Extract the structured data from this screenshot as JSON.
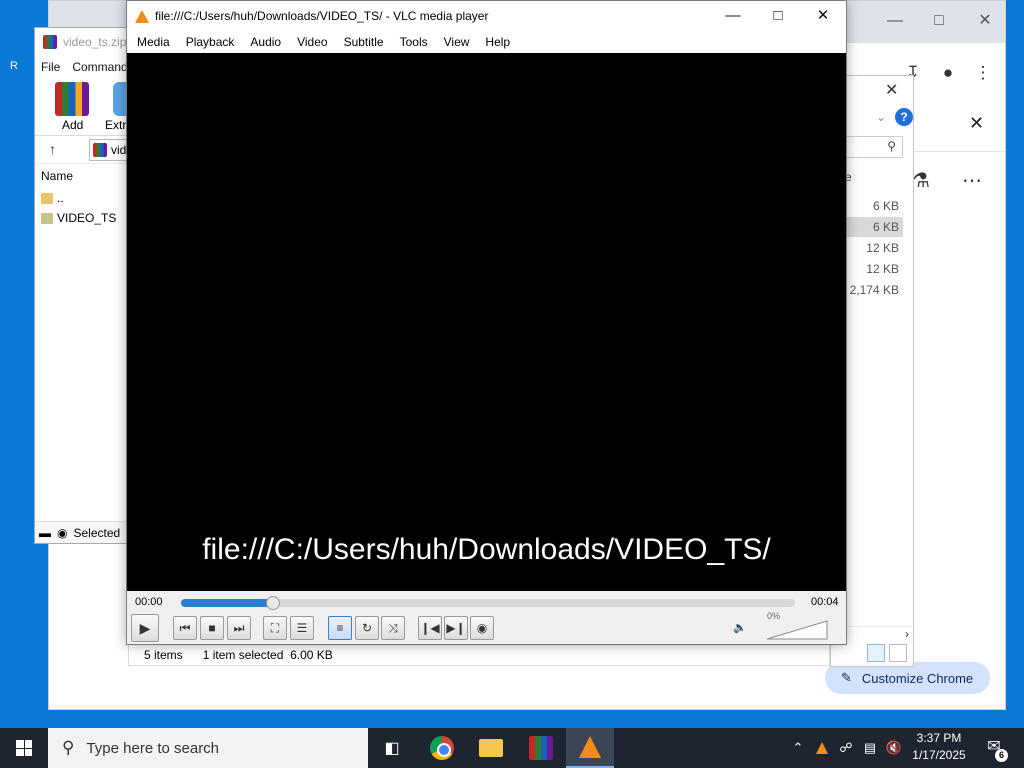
{
  "vlc": {
    "title": "file:///C:/Users/huh/Downloads/VIDEO_TS/ - VLC media player",
    "menu": [
      "Media",
      "Playback",
      "Audio",
      "Video",
      "Subtitle",
      "Tools",
      "View",
      "Help"
    ],
    "overlay_text": "file:///C:/Users/huh/Downloads/VIDEO_TS/",
    "elapsed": "00:00",
    "duration": "00:04",
    "progress_fraction": 0.15,
    "volume_percent": "0%"
  },
  "winrar": {
    "title": "video_ts.zip",
    "menu": [
      "File",
      "Command"
    ],
    "add_label": "Add",
    "extract_label": "Extr",
    "address": "vid",
    "column_name": "Name",
    "rows": [
      "..",
      "VIDEO_TS"
    ],
    "status": "Selected"
  },
  "explorer": {
    "col_header": "e",
    "sizes": [
      "6 KB",
      "6 KB",
      "12 KB",
      "12 KB",
      "2,174 KB"
    ],
    "status_items": "5 items",
    "status_selected": "1 item selected",
    "status_size": "6.00 KB"
  },
  "chrome": {
    "customize_label": "Customize Chrome"
  },
  "taskbar": {
    "search_placeholder": "Type here to search",
    "time": "3:37 PM",
    "date": "1/17/2025",
    "notification_count": "6"
  },
  "icons": {
    "vlc": "vlc-cone-icon",
    "winrar": "winrar-books-icon",
    "chrome": "chrome-icon",
    "explorer": "folder-icon",
    "windows": "windows-logo-icon"
  }
}
